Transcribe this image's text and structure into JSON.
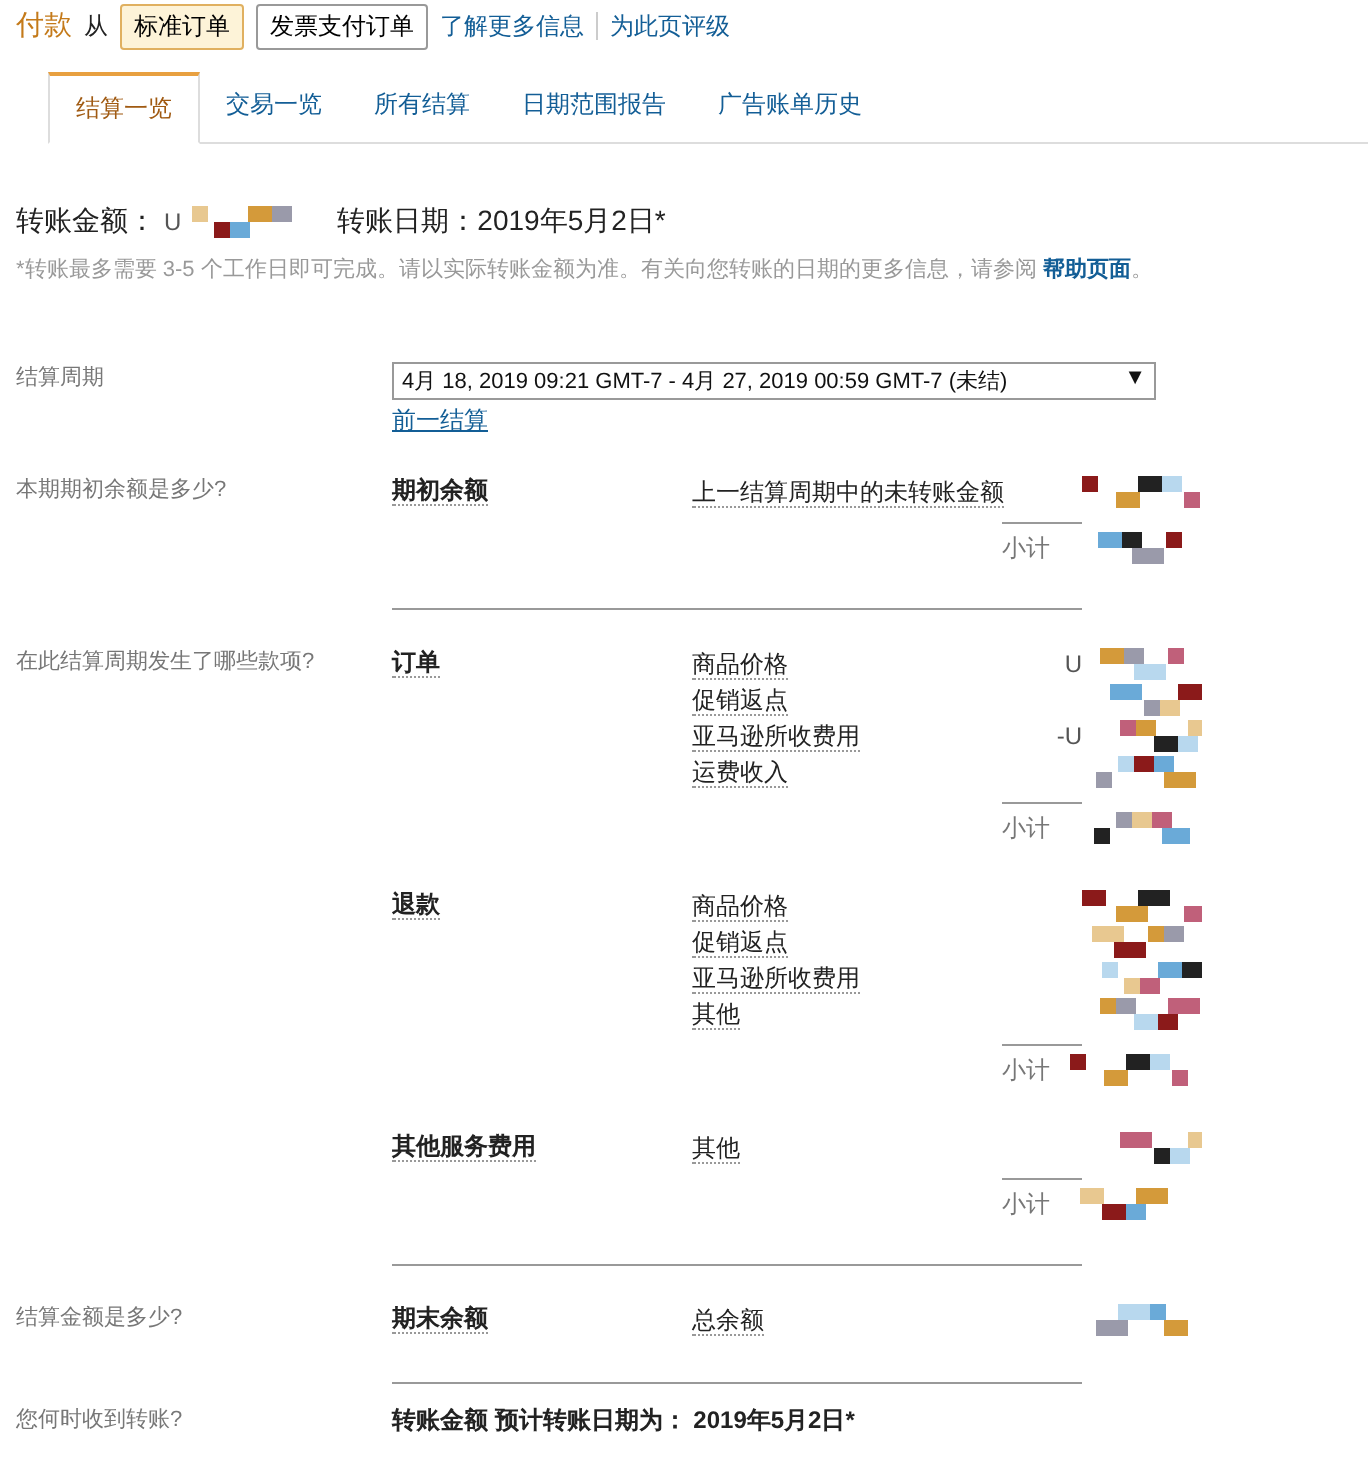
{
  "header": {
    "title": "付款",
    "from": "从",
    "buttons": [
      {
        "label": "标准订单",
        "selected": true
      },
      {
        "label": "发票支付订单",
        "selected": false
      }
    ],
    "links": [
      "了解更多信息",
      "为此页评级"
    ]
  },
  "tabs": [
    {
      "label": "结算一览",
      "selected": true
    },
    {
      "label": "交易一览",
      "selected": false
    },
    {
      "label": "所有结算",
      "selected": false
    },
    {
      "label": "日期范围报告",
      "selected": false
    },
    {
      "label": "广告账单历史",
      "selected": false
    }
  ],
  "transfer": {
    "amount_label": "转账金额：",
    "amount_prefix": "U",
    "date_label": "转账日期：",
    "date": "2019年5月2日*"
  },
  "note": {
    "text": "*转账最多需要 3-5 个工作日即可完成。请以实际转账金额为准。有关向您转账的日期的更多信息，请参阅 ",
    "link": "帮助页面",
    "end": "。"
  },
  "period": {
    "label": "结算周期",
    "value": "4月 18, 2019 09:21 GMT-7 - 4月 27, 2019 00:59 GMT-7   (未结)",
    "arrow": "▼",
    "link": "前一结算"
  },
  "sections": [
    {
      "question": "本期期初余额是多少?",
      "groups": [
        {
          "title": "期初余额",
          "items": [
            {
              "label": "上一结算周期中的未转账金额"
            }
          ],
          "subtotal": "小计"
        }
      ]
    },
    {
      "question": "在此结算周期发生了哪些款项?",
      "groups": [
        {
          "title": "订单",
          "items": [
            {
              "label": "商品价格",
              "prefix": "U"
            },
            {
              "label": "促销返点"
            },
            {
              "label": "亚马逊所收费用",
              "prefix": "-U"
            },
            {
              "label": "运费收入"
            }
          ],
          "subtotal": "小计"
        },
        {
          "title": "退款",
          "items": [
            {
              "label": "商品价格"
            },
            {
              "label": "促销返点"
            },
            {
              "label": "亚马逊所收费用"
            },
            {
              "label": "其他"
            }
          ],
          "subtotal": "小计"
        },
        {
          "title": "其他服务费用",
          "items": [
            {
              "label": "其他"
            }
          ],
          "subtotal": "小计"
        }
      ]
    },
    {
      "question": "结算金额是多少?",
      "groups": [
        {
          "title": "期末余额",
          "items": [
            {
              "label": "总余额"
            }
          ]
        }
      ]
    }
  ],
  "final": {
    "question": "您何时收到转账?",
    "text": "转账金额 预计转账日期为：  2019年5月2日*"
  }
}
